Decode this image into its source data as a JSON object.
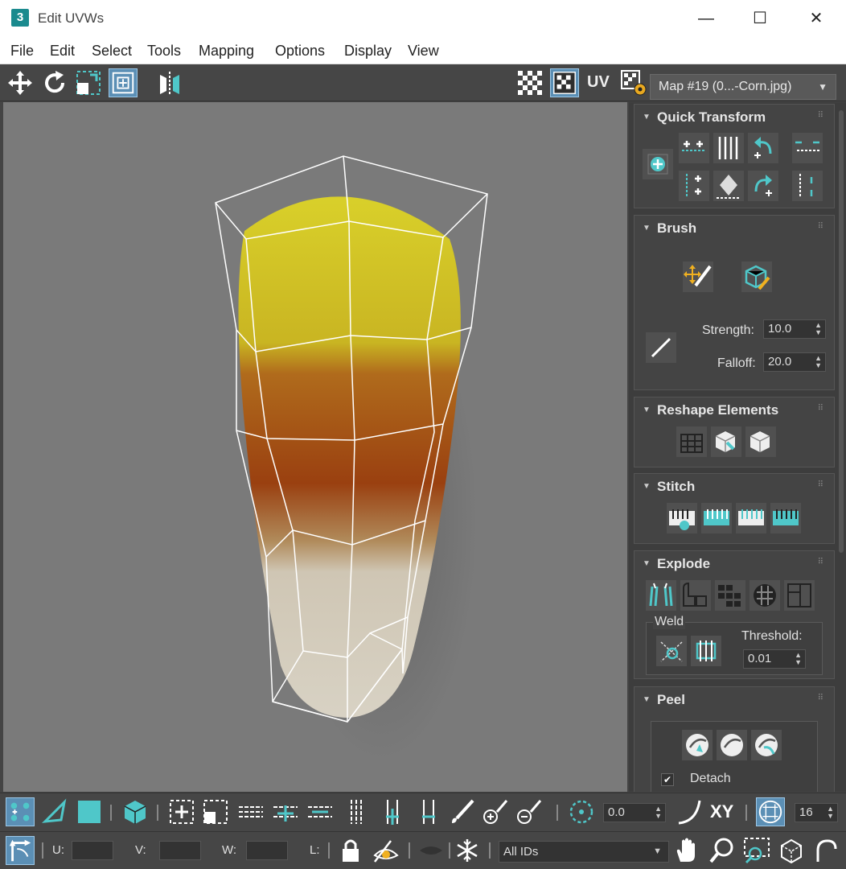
{
  "window": {
    "app_badge": "3",
    "title": "Edit UVWs",
    "minimize": "—",
    "maximize": "☐",
    "close": "✕"
  },
  "menu": [
    "File",
    "Edit",
    "Select",
    "Tools",
    "Mapping",
    "Options",
    "Display",
    "View"
  ],
  "toolbar": {
    "icons": [
      "move-icon",
      "rotate-icon",
      "scale-icon",
      "freeform-icon",
      "mirror-icon",
      "checker-pattern-icon",
      "show-map-icon",
      "uv-label",
      "settings-icon"
    ],
    "uv_label": "UV",
    "map_select": "Map #19 (0...-Corn.jpg)"
  },
  "panel": {
    "quick_transform": {
      "title": "Quick Transform"
    },
    "brush": {
      "title": "Brush",
      "strength_label": "Strength:",
      "strength_value": "10.0",
      "falloff_label": "Falloff:",
      "falloff_value": "20.0"
    },
    "reshape": {
      "title": "Reshape Elements"
    },
    "stitch": {
      "title": "Stitch"
    },
    "explode": {
      "title": "Explode",
      "weld_label": "Weld",
      "threshold_label": "Threshold:",
      "threshold_value": "0.01"
    },
    "peel": {
      "title": "Peel",
      "detach_label": "Detach",
      "detach_checked": true
    }
  },
  "bottom": {
    "rotation_value": "0.0",
    "xy_label": "XY",
    "grid_value": "16",
    "u_label": "U:",
    "v_label": "V:",
    "w_label": "W:",
    "l_label": "L:",
    "ids_value": "All IDs"
  },
  "colors": {
    "accent": "#4fc7c9",
    "selection": "#5b8fb5",
    "panel_bg": "#3d3d3d",
    "toolbar_bg": "#464646",
    "viewport_bg": "#7a7a7a"
  }
}
